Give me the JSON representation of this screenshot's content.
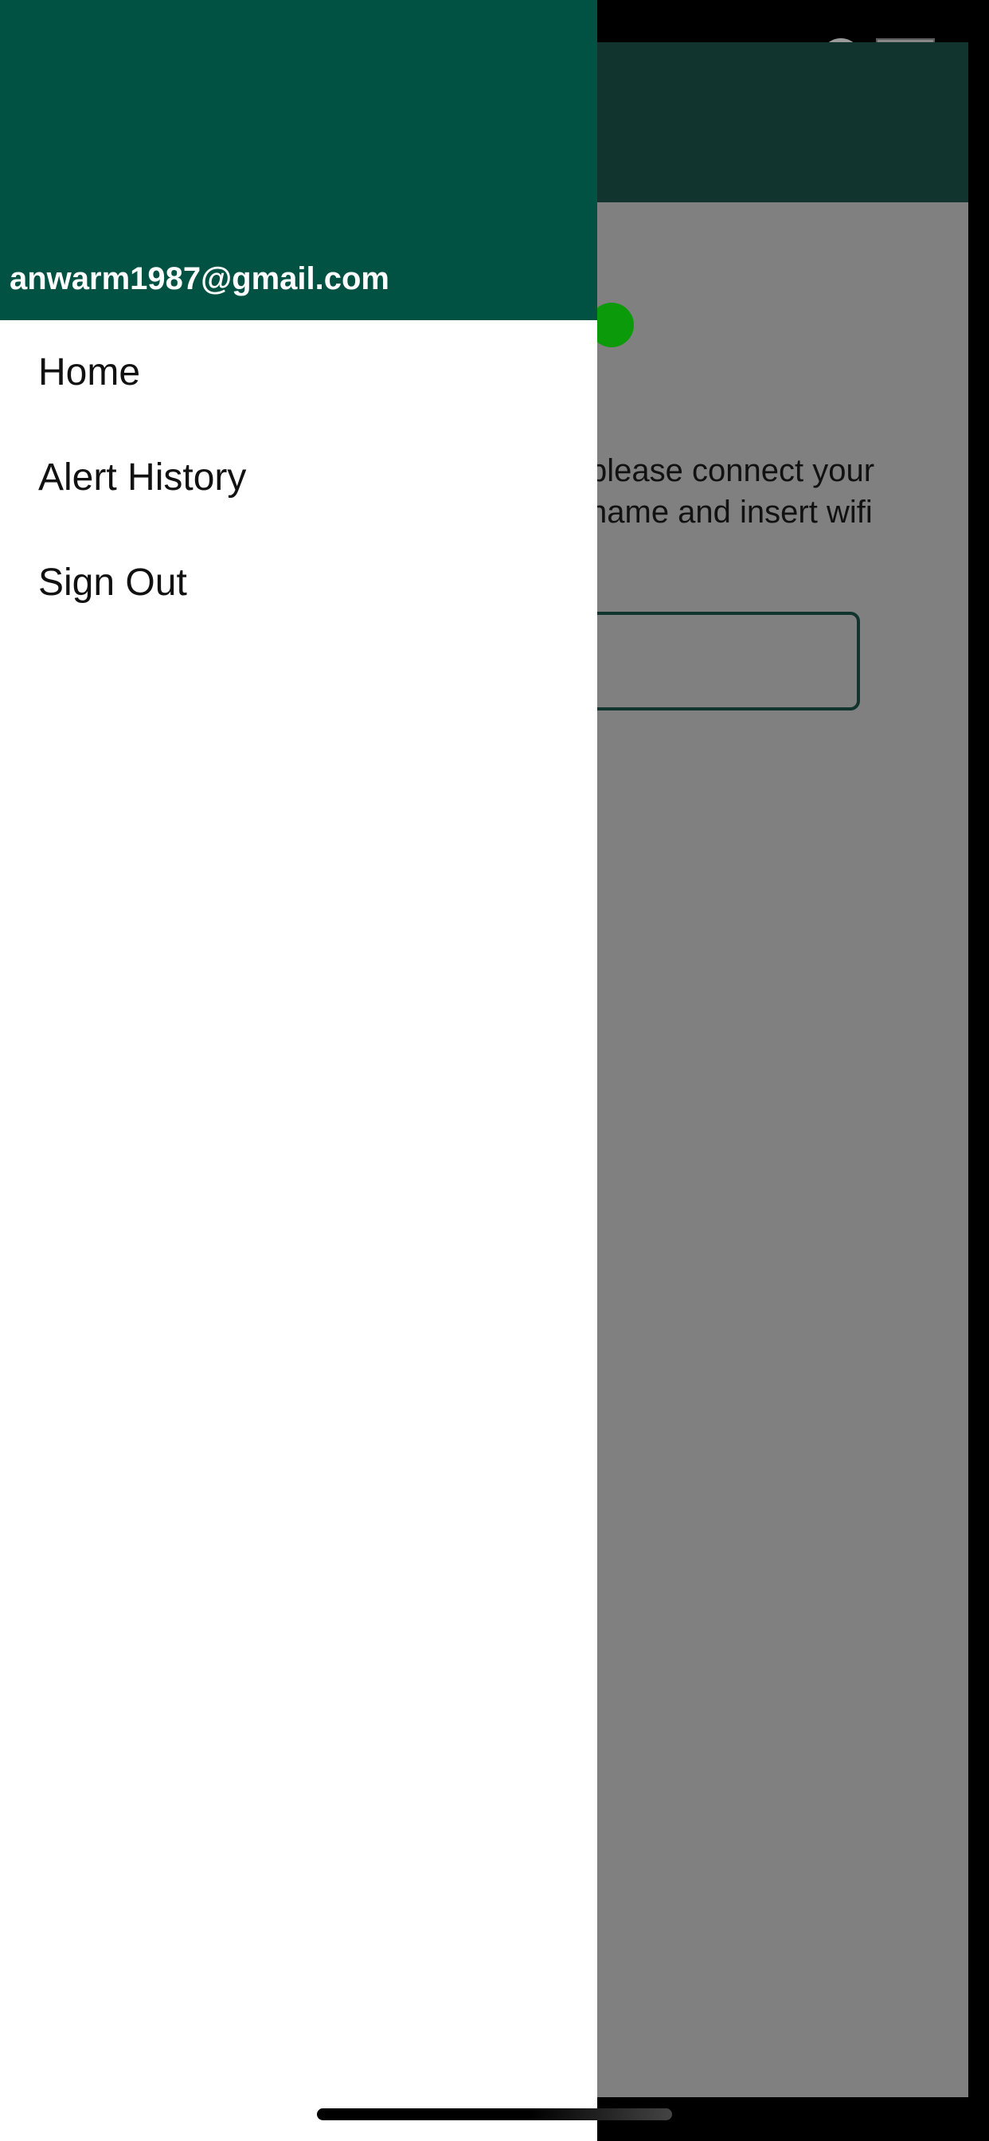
{
  "drawer": {
    "email": "anwarm1987@gmail.com",
    "items": [
      {
        "label": "Home"
      },
      {
        "label": "Alert History"
      },
      {
        "label": "Sign Out"
      }
    ]
  },
  "background": {
    "instructions_line1": " please connect your",
    "instructions_line2": "name and insert wifi",
    "input_partial": "("
  },
  "colors": {
    "drawer_header": "#015243",
    "app_header_dimmed": "#12342e",
    "status_dot": "#0a9a0a",
    "overlay": "#808080"
  }
}
